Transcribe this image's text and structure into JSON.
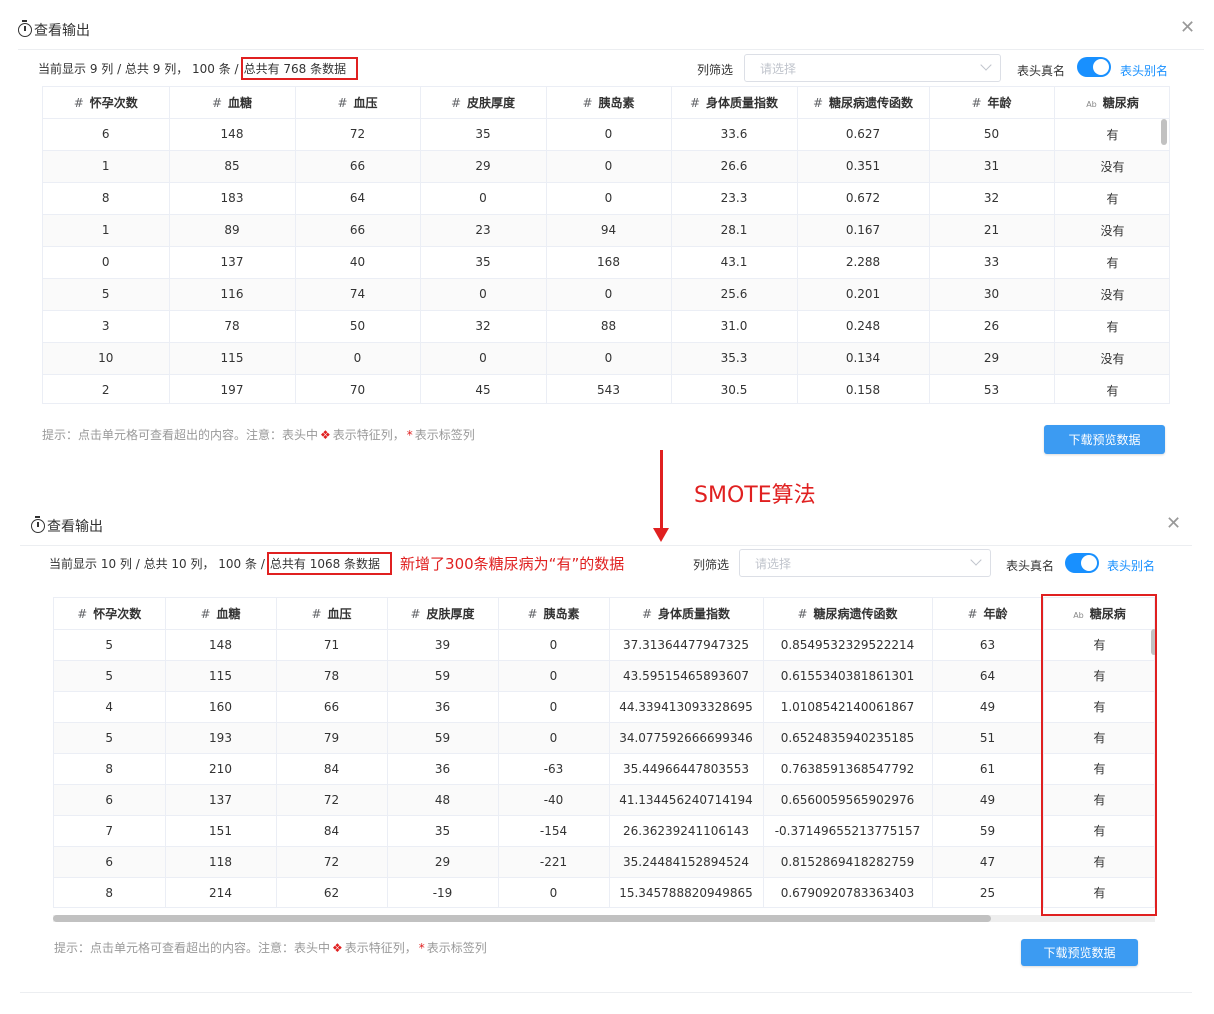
{
  "top": {
    "title": "查看输出",
    "info_prefix": "当前显示 9 列 / 总共 9 列， 100 条 /",
    "info_boxed": "总共有 768 条数据",
    "filter_label": "列筛选",
    "select_placeholder": "请选择",
    "toggle_label": "表头真名",
    "alias_label": "表头别名",
    "columns": [
      {
        "kind": "#",
        "name": "怀孕次数"
      },
      {
        "kind": "#",
        "name": "血糖"
      },
      {
        "kind": "#",
        "name": "血压"
      },
      {
        "kind": "#",
        "name": "皮肤厚度"
      },
      {
        "kind": "#",
        "name": "胰岛素"
      },
      {
        "kind": "#",
        "name": "身体质量指数"
      },
      {
        "kind": "#",
        "name": "糖尿病遗传函数"
      },
      {
        "kind": "#",
        "name": "年龄"
      },
      {
        "kind": "Ab",
        "name": "糖尿病"
      }
    ],
    "rows": [
      [
        "6",
        "148",
        "72",
        "35",
        "0",
        "33.6",
        "0.627",
        "50",
        "有"
      ],
      [
        "1",
        "85",
        "66",
        "29",
        "0",
        "26.6",
        "0.351",
        "31",
        "没有"
      ],
      [
        "8",
        "183",
        "64",
        "0",
        "0",
        "23.3",
        "0.672",
        "32",
        "有"
      ],
      [
        "1",
        "89",
        "66",
        "23",
        "94",
        "28.1",
        "0.167",
        "21",
        "没有"
      ],
      [
        "0",
        "137",
        "40",
        "35",
        "168",
        "43.1",
        "2.288",
        "33",
        "有"
      ],
      [
        "5",
        "116",
        "74",
        "0",
        "0",
        "25.6",
        "0.201",
        "30",
        "没有"
      ],
      [
        "3",
        "78",
        "50",
        "32",
        "88",
        "31.0",
        "0.248",
        "26",
        "有"
      ],
      [
        "10",
        "115",
        "0",
        "0",
        "0",
        "35.3",
        "0.134",
        "29",
        "没有"
      ],
      [
        "2",
        "197",
        "70",
        "45",
        "543",
        "30.5",
        "0.158",
        "53",
        "有"
      ]
    ],
    "hint": {
      "before": "提示：点击单元格可查看超出的内容。注意：表头中",
      "diamond": "❖",
      "middle": "表示特征列，",
      "star": "*",
      "after": "表示标签列"
    },
    "download_label": "下载预览数据"
  },
  "annotation": {
    "smote_label": "SMOTE算法",
    "added_note": "新增了300条糖尿病为“有”的数据"
  },
  "bottom": {
    "title": "查看输出",
    "info_prefix": "当前显示 10 列 / 总共 10 列， 100 条 /",
    "info_boxed": "总共有 1068 条数据",
    "filter_label": "列筛选",
    "select_placeholder": "请选择",
    "toggle_label": "表头真名",
    "alias_label": "表头别名",
    "columns": [
      {
        "kind": "#",
        "name": "怀孕次数"
      },
      {
        "kind": "#",
        "name": "血糖"
      },
      {
        "kind": "#",
        "name": "血压"
      },
      {
        "kind": "#",
        "name": "皮肤厚度"
      },
      {
        "kind": "#",
        "name": "胰岛素"
      },
      {
        "kind": "#",
        "name": "身体质量指数"
      },
      {
        "kind": "#",
        "name": "糖尿病遗传函数"
      },
      {
        "kind": "#",
        "name": "年龄"
      },
      {
        "kind": "Ab",
        "name": "糖尿病"
      }
    ],
    "rows": [
      [
        "5",
        "148",
        "71",
        "39",
        "0",
        "37.31364477947325",
        "0.8549532329522214",
        "63",
        "有"
      ],
      [
        "5",
        "115",
        "78",
        "59",
        "0",
        "43.59515465893607",
        "0.6155340381861301",
        "64",
        "有"
      ],
      [
        "4",
        "160",
        "66",
        "36",
        "0",
        "44.339413093328695",
        "1.0108542140061867",
        "49",
        "有"
      ],
      [
        "5",
        "193",
        "79",
        "59",
        "0",
        "34.077592666699346",
        "0.6524835940235185",
        "51",
        "有"
      ],
      [
        "8",
        "210",
        "84",
        "36",
        "-63",
        "35.44966447803553",
        "0.7638591368547792",
        "61",
        "有"
      ],
      [
        "6",
        "137",
        "72",
        "48",
        "-40",
        "41.134456240714194",
        "0.6560059565902976",
        "49",
        "有"
      ],
      [
        "7",
        "151",
        "84",
        "35",
        "-154",
        "26.36239241106143",
        "-0.37149655213775157",
        "59",
        "有"
      ],
      [
        "6",
        "118",
        "72",
        "29",
        "-221",
        "35.24484152894524",
        "0.8152869418282759",
        "47",
        "有"
      ],
      [
        "8",
        "214",
        "62",
        "-19",
        "0",
        "15.345788820949865",
        "0.6790920783363403",
        "25",
        "有"
      ]
    ],
    "hint": {
      "before": "提示：点击单元格可查看超出的内容。注意：表头中",
      "diamond": "❖",
      "middle": "表示特征列，",
      "star": "*",
      "after": "表示标签列"
    },
    "download_label": "下载预览数据"
  },
  "colors": {
    "accent": "#1890ff",
    "button": "#3c9bf2",
    "annotation_red": "#e02020"
  }
}
